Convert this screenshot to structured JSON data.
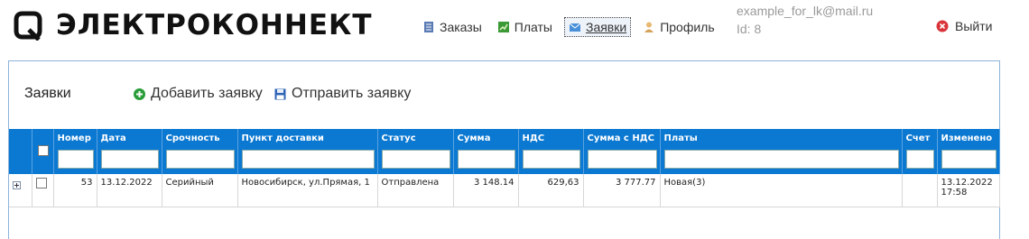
{
  "header": {
    "brand": "ЭЛЕКТРОКОННЕКТ",
    "nav": [
      {
        "label": "Заказы",
        "icon": "orders-icon",
        "active": false
      },
      {
        "label": "Платы",
        "icon": "boards-icon",
        "active": false
      },
      {
        "label": "Заявки",
        "icon": "requests-icon",
        "active": true
      },
      {
        "label": "Профиль",
        "icon": "profile-icon",
        "active": false
      }
    ],
    "account": {
      "email": "example_for_lk@mail.ru",
      "id": "Id: 8"
    },
    "logout": "Выйти"
  },
  "panel": {
    "title": "Заявки",
    "add_label": "Добавить заявку",
    "send_label": "Отправить заявку"
  },
  "table": {
    "columns": [
      "Номер",
      "Дата",
      "Срочность",
      "Пункт доставки",
      "Статус",
      "Сумма",
      "НДС",
      "Сумма с НДС",
      "Платы",
      "Счет",
      "Изменено"
    ],
    "rows": [
      {
        "number": "53",
        "date": "13.12.2022",
        "urgency": "Серийный",
        "delivery": "Новосибирск, ул.Прямая, 1",
        "status": "Отправлена",
        "sum": "3 148.14",
        "vat": "629,63",
        "sum_vat": "3 777.77",
        "boards": "Новая(3)",
        "invoice": "",
        "changed_date": "13.12.2022",
        "changed_time": "17:58"
      }
    ]
  },
  "colors": {
    "header_bg": "#0b78d1",
    "panel_border": "#8fb3d9",
    "logout_red": "#d9343a",
    "add_green": "#2a9d3a"
  }
}
